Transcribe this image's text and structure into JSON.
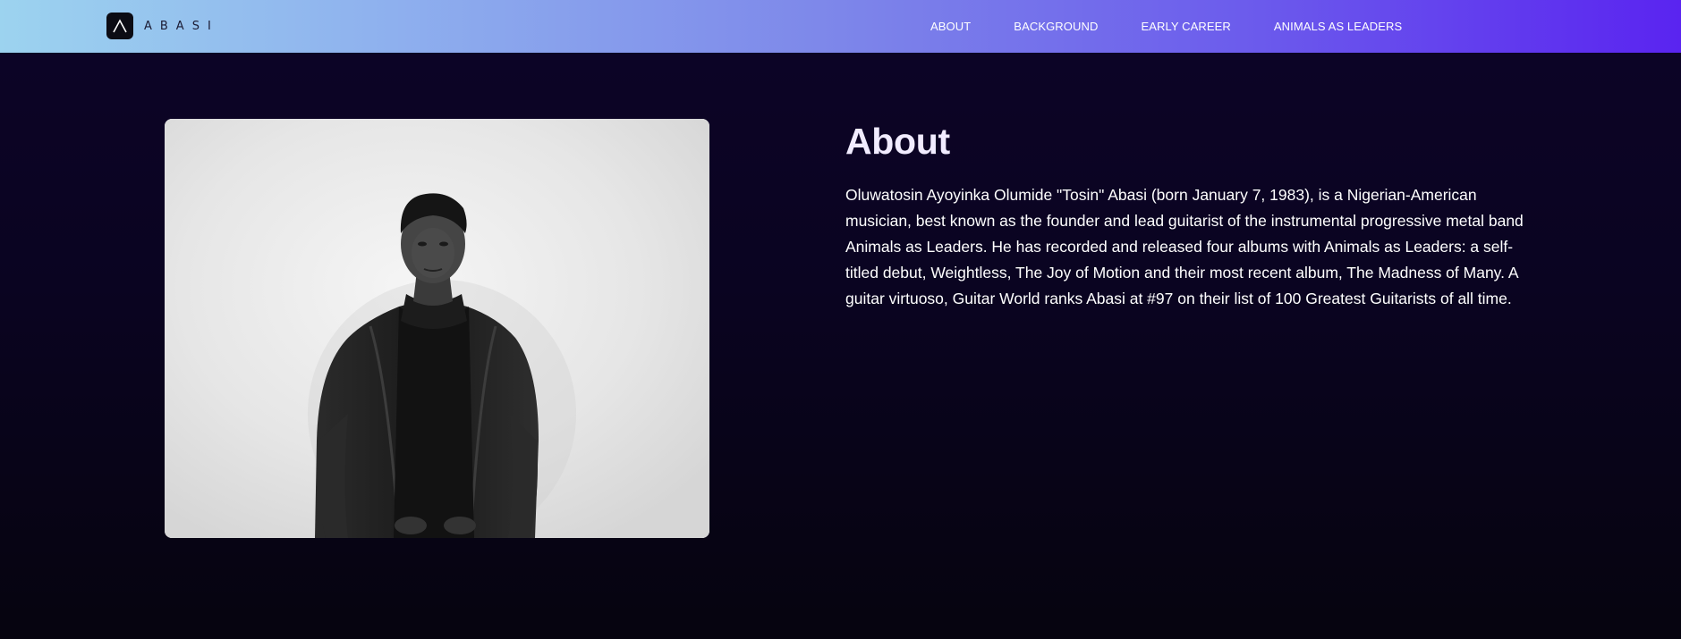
{
  "header": {
    "brand_name": "ABASI",
    "nav_items": [
      {
        "label": "ABOUT"
      },
      {
        "label": "BACKGROUND"
      },
      {
        "label": "EARLY CAREER"
      },
      {
        "label": "ANIMALS AS LEADERS"
      }
    ]
  },
  "about": {
    "title": "About",
    "body": "Oluwatosin Ayoyinka Olumide \"Tosin\" Abasi (born January 7, 1983), is a Nigerian-American musician, best known as the founder and lead guitarist of the instrumental progressive metal band Animals as Leaders. He has recorded and released four albums with Animals as Leaders: a self-titled debut, Weightless, The Joy of Motion and their most recent album, The Madness of Many. A guitar virtuoso, Guitar World ranks Abasi at #97 on their list of 100 Greatest Guitarists of all time."
  },
  "colors": {
    "header_gradient_start": "#9cd3ef",
    "header_gradient_end": "#5a24f0",
    "page_background": "#0a0421",
    "title_color": "#f1ecff"
  },
  "icons": {
    "logo": "abasi-logo-mark"
  }
}
